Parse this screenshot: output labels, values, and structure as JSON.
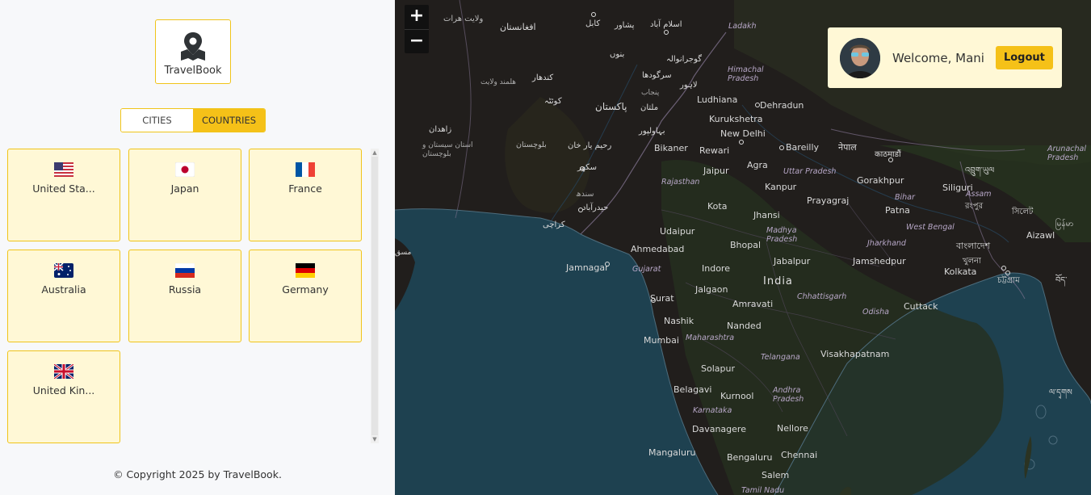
{
  "app": {
    "logo_text": "TravelBook"
  },
  "tabs": [
    {
      "label": "CITIES",
      "active": false
    },
    {
      "label": "COUNTRIES",
      "active": true
    }
  ],
  "countries": [
    {
      "name": "United Sta...",
      "flag": "us-flag-icon"
    },
    {
      "name": "Japan",
      "flag": "jp-flag-icon"
    },
    {
      "name": "France",
      "flag": "fr-flag-icon"
    },
    {
      "name": "Australia",
      "flag": "au-flag-icon"
    },
    {
      "name": "Russia",
      "flag": "ru-flag-icon"
    },
    {
      "name": "Germany",
      "flag": "de-flag-icon"
    },
    {
      "name": "United Kin...",
      "flag": "gb-flag-icon"
    }
  ],
  "footer": {
    "text": "© Copyright 2025 by TravelBook."
  },
  "user": {
    "welcome": "Welcome, Mani",
    "logout_label": "Logout"
  },
  "map": {
    "zoom_in": "+",
    "zoom_out": "−",
    "labels": {
      "afghanistan": "افغانستان",
      "herat": "ولایت هرات",
      "kabul": "کابل",
      "peshawar": "پشاور",
      "islamabad": "اسلام آباد",
      "ladakh": "Ladakh",
      "kandahar": "کندهار",
      "helmand": "هلمند ولایت",
      "quetta": "کوئٹہ",
      "pakistan": "پاکستان",
      "multan": "ملتان",
      "lahore": "لاہور",
      "gujranwala": "گوجرانوالہ",
      "sargodha": "سرگودھا",
      "punjab": "پنجاب",
      "bannu": "بنوں",
      "himachal": "Himachal Pradesh",
      "ludhiana": "Ludhiana",
      "dehradun": "Dehradun",
      "kurukshetra": "Kurukshetra",
      "new_delhi": "New Delhi",
      "bareilly": "Bareilly",
      "nepal": "नेपाल",
      "kathmandu": "काठमाडौं",
      "zahedan": "زاهدان",
      "sistan": "استان سیستان و بلوچستان",
      "balochistan": "بلوچستان",
      "bahawalpur": "بہاولپور",
      "rahim_yar_khan": "رحیم یار خان",
      "sukkur": "سکھر",
      "sindh": "سندھ",
      "hyderabad": "حیدرآباد",
      "karachi": "کراچی",
      "bikaner": "Bikaner",
      "rewari": "Rewari",
      "jaipur": "Jaipur",
      "agra": "Agra",
      "uttar_pradesh": "Uttar Pradesh",
      "rajasthan": "Rajasthan",
      "kanpur": "Kanpur",
      "gorakhpur": "Gorakhpur",
      "siliguri": "Siliguri",
      "bhutan": "འབྲུག་ཡུལ",
      "arunachal": "Arunachal Pradesh",
      "bihar": "Bihar",
      "assam": "Assam",
      "prayagraj": "Prayagraj",
      "patna": "Patna",
      "rangpur": "রংপুর",
      "sylhet": "সিলেট",
      "aizawl": "Aizawl",
      "kota": "Kota",
      "jhansi": "Jhansi",
      "udaipur": "Udaipur",
      "madhya_pradesh": "Madhya Pradesh",
      "jharkhand": "Jharkhand",
      "west_bengal": "West Bengal",
      "bangladesh": "বাংলাদেশ",
      "khulna": "খুলনা",
      "ahmedabad": "Ahmedabad",
      "bhopal": "Bhopal",
      "jamnagar": "Jamnagar",
      "gujarat": "Gujarat",
      "indore": "Indore",
      "jabalpur": "Jabalpur",
      "jamshedpur": "Jamshedpur",
      "kolkata": "Kolkata",
      "chattogram": "চট্টগ্রাম",
      "india": "India",
      "jalgaon": "Jalgaon",
      "chhattisgarh": "Chhattisgarh",
      "surat": "Surat",
      "amravati": "Amravati",
      "odisha": "Odisha",
      "cuttack": "Cuttack",
      "nashik": "Nashik",
      "nanded": "Nanded",
      "mumbai": "Mumbai",
      "maharashtra": "Maharashtra",
      "telangana": "Telangana",
      "visakhapatnam": "Visakhapatnam",
      "solapur": "Solapur",
      "belagavi": "Belagavi",
      "kurnool": "Kurnool",
      "andhra": "Andhra Pradesh",
      "karnataka": "Karnataka",
      "davanagere": "Davanagere",
      "nellore": "Nellore",
      "mangaluru": "Mangaluru",
      "bengaluru": "Bengaluru",
      "chennai": "Chennai",
      "salem": "Salem",
      "tamil_nadu": "Tamil Nadu",
      "muscat": "مسق",
      "myanmar": "မြန်မာ",
      "ladakh_script": "ལ་དྭགས",
      "tibet": "བོད་"
    }
  }
}
